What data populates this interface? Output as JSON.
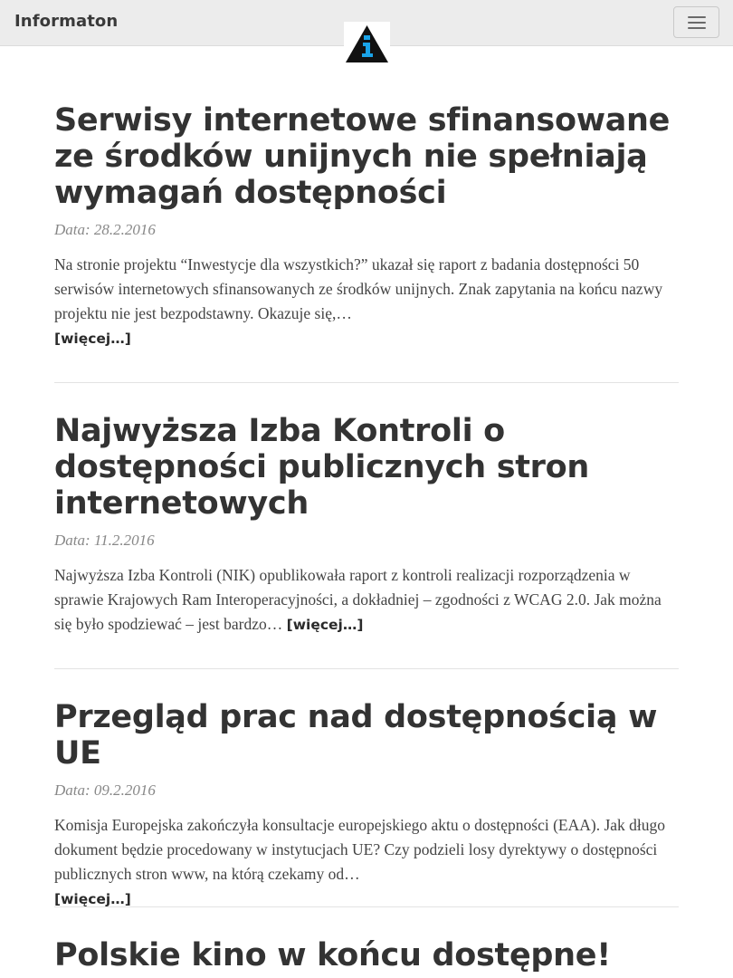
{
  "navbar": {
    "brand": "Informaton",
    "logo_icon": "info-triangle-logo-icon",
    "toggle_icon": "hamburger-menu-icon"
  },
  "colors": {
    "navbar_bg": "#ececec",
    "logo_accent": "#1aa3e8",
    "text": "#333333",
    "date": "#888888"
  },
  "articles": [
    {
      "title": "Serwisy internetowe sfinansowane ze środków unijnych nie spełniają wymagań dostępności",
      "date": "Data: 28.2.2016",
      "excerpt": "Na stronie projektu “Inwestycje dla wszystkich?” ukazał się raport z badania dostępności 50 serwisów internetowych sfinansowanych ze środków unijnych. Znak zapytania na końcu nazwy projektu nie jest bezpodstawny. Okazuje się,…",
      "more": "[więcej…]"
    },
    {
      "title": "Najwyższa Izba Kontroli o dostępności publicznych stron internetowych",
      "date": "Data: 11.2.2016",
      "excerpt": "Najwyższa Izba Kontroli (NIK) opublikowała raport z kontroli realizacji rozporządzenia w sprawie Krajowych Ram Interoperacyjności, a dokładniej – zgodności z WCAG 2.0. Jak można się było spodziewać – jest bardzo…",
      "more": "[więcej…]"
    },
    {
      "title": "Przegląd prac nad dostępnością w UE",
      "date": "Data: 09.2.2016",
      "excerpt": "Komisja Europejska zakończyła konsultacje europejskiego aktu o dostępności (EAA). Jak długo dokument będzie procedowany w instytucjach UE? Czy podzieli losy dyrektywy o dostępności publicznych stron www, na którą czekamy od…",
      "more": "[więcej…]"
    },
    {
      "title": "Polskie kino w końcu dostępne!"
    }
  ]
}
